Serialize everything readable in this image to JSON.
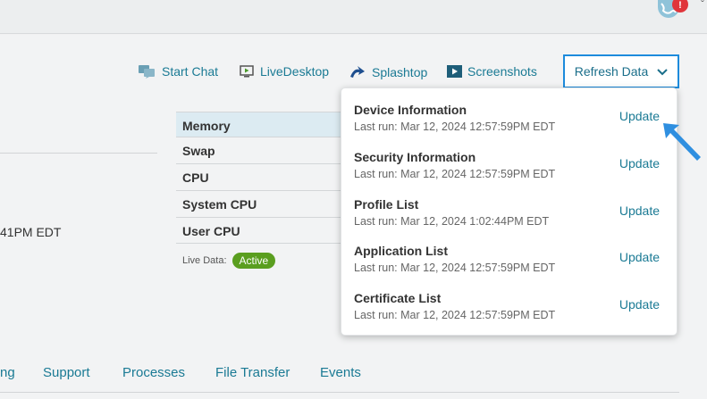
{
  "topbar": {
    "notification_count": "!"
  },
  "actions": {
    "start_chat": "Start Chat",
    "live_desktop": "LiveDesktop",
    "splashtop": "Splashtop",
    "screenshots": "Screenshots",
    "refresh_data": "Refresh Data"
  },
  "left_panel": {
    "timestamp_fragment": "41PM EDT"
  },
  "stats": {
    "rows": [
      "Memory",
      "Swap",
      "CPU",
      "System CPU",
      "User CPU"
    ],
    "live_data_label": "Live Data:",
    "live_status": "Active"
  },
  "dropdown": {
    "items": [
      {
        "title": "Device Information",
        "last_run": "Last run: Mar 12, 2024 12:57:59PM EDT",
        "action": "Update"
      },
      {
        "title": "Security Information",
        "last_run": "Last run: Mar 12, 2024 12:57:59PM EDT",
        "action": "Update"
      },
      {
        "title": "Profile List",
        "last_run": "Last run: Mar 12, 2024 1:02:44PM EDT",
        "action": "Update"
      },
      {
        "title": "Application List",
        "last_run": "Last run: Mar 12, 2024 12:57:59PM EDT",
        "action": "Update"
      },
      {
        "title": "Certificate List",
        "last_run": "Last run: Mar 12, 2024 12:57:59PM EDT",
        "action": "Update"
      }
    ]
  },
  "tabs": {
    "items": [
      "ng",
      "Support",
      "Processes",
      "File Transfer",
      "Events"
    ]
  },
  "colors": {
    "link": "#1a7a94",
    "focus_border": "#1d8bdc",
    "active_badge": "#5a9e1f",
    "notification": "#e0353b"
  },
  "icons": {
    "start_chat": "chat-icon",
    "live_desktop": "monitor-icon",
    "splashtop": "splashtop-icon",
    "screenshots": "play-screen-icon",
    "refresh_data": "chevron-down-icon",
    "pointer": "arrow-pointer-icon"
  }
}
